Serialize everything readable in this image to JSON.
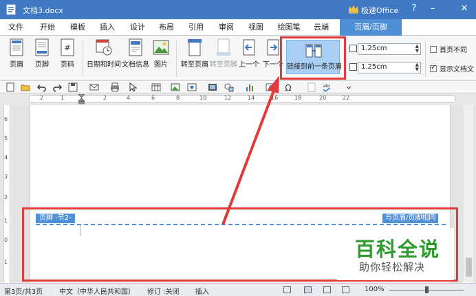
{
  "titlebar": {
    "doc_title": "文档3.docx",
    "brand": "极速Office",
    "help": "?",
    "minimize": "–",
    "close": "✕"
  },
  "menu": [
    {
      "label": "文件"
    },
    {
      "label": "开始"
    },
    {
      "label": "模板"
    },
    {
      "label": "插入"
    },
    {
      "label": "设计"
    },
    {
      "label": "布局"
    },
    {
      "label": "引用"
    },
    {
      "label": "审阅"
    },
    {
      "label": "视图"
    },
    {
      "label": "绘图笔"
    },
    {
      "label": "云端"
    },
    {
      "label": "页眉/页脚"
    }
  ],
  "ribbon": {
    "header": "页眉",
    "footer": "页脚",
    "page_number": "页码",
    "date_time": "日期和时间",
    "doc_info": "文档信息",
    "picture": "图片",
    "goto_header": "转至页眉",
    "goto_footer": "转至页脚",
    "previous": "上一个",
    "next": "下一个",
    "link_previous": "链接到前一条页眉",
    "header_distance": "1.25cm",
    "footer_distance": "1.25cm",
    "first_page_different": "首页不同",
    "show_doc_text": "显示文档文"
  },
  "ruler": {
    "h_numbers": [
      "2",
      "1",
      "2",
      "4",
      "6",
      "8",
      "10",
      "12",
      "14",
      "16",
      "18",
      "20",
      "22"
    ],
    "v_numbers": [
      "6",
      "5",
      "4",
      "3",
      "2",
      "1",
      "0",
      "1"
    ]
  },
  "page": {
    "footer_label": "页脚 -节2-",
    "same_as_previous": "与页眉/页脚相同"
  },
  "watermark": {
    "big": "百科全说",
    "small": "助你轻松解决"
  },
  "status": {
    "page": "第3页/共3页",
    "language": "中文（中华人民共和国）",
    "revision": "修订 :关闭",
    "insert": "插入",
    "zoom": "100%"
  },
  "colors": {
    "titlebar": "#3f79c4",
    "accent": "#4f8fd6",
    "highlight": "#a9cff5",
    "annotation": "#e23a3a"
  }
}
